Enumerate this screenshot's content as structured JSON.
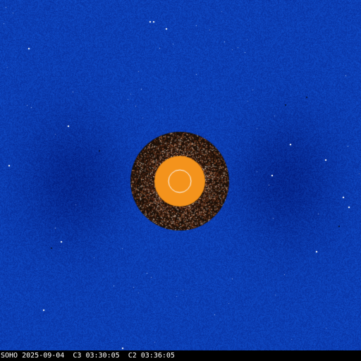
{
  "image": {
    "colors": {
      "background": "#0b3db3",
      "background_light": "#1c56d2",
      "background_dark": "#072a85",
      "occulter_outer": "#1a0f08",
      "occulter_inner": "#f4931c",
      "sun_outline": "#ffffff",
      "caption_bg": "#000000",
      "caption_text": "#ffffff"
    }
  },
  "caption": {
    "observatory": "SOHO",
    "date": "2025-09-04",
    "c3_label": "C3",
    "c3_time": "03:30:05",
    "c2_label": "C2",
    "c2_time": "03:36:05"
  }
}
